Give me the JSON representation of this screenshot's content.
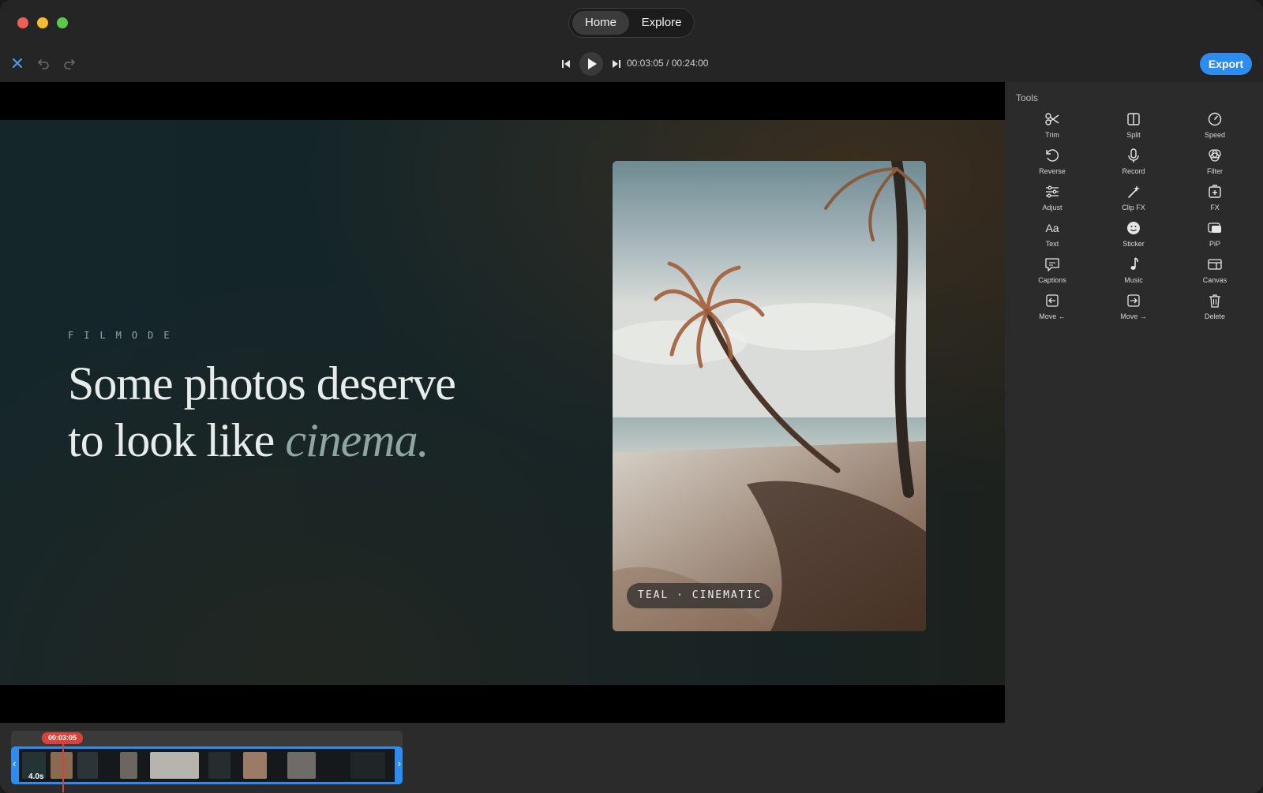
{
  "titlebar": {
    "tabs": [
      {
        "label": "Home",
        "selected": true
      },
      {
        "label": "Explore",
        "selected": false
      }
    ]
  },
  "toolbar": {
    "close_icon": "close-icon",
    "undo_icon": "undo-icon",
    "redo_icon": "redo-icon",
    "timecode": "00:03:05 / 00:24:00",
    "export_label": "Export",
    "accent_color": "#2d8cf0"
  },
  "preview": {
    "brand": "FILMODE",
    "headline_line1": "Some photos deserve",
    "headline_line2_prefix": "to look like ",
    "headline_line2_emphasis": "cinema.",
    "photo_tag": "TEAL · CINEMATIC",
    "background_color": "#14262a"
  },
  "tools": {
    "title": "Tools",
    "items": [
      {
        "label": "Trim",
        "icon": "scissors-icon"
      },
      {
        "label": "Split",
        "icon": "split-icon"
      },
      {
        "label": "Speed",
        "icon": "speedometer-icon"
      },
      {
        "label": "Reverse",
        "icon": "reverse-icon"
      },
      {
        "label": "Record",
        "icon": "microphone-icon"
      },
      {
        "label": "Filter",
        "icon": "filter-icon"
      },
      {
        "label": "Adjust",
        "icon": "sliders-icon"
      },
      {
        "label": "Clip FX",
        "icon": "magic-wand-icon"
      },
      {
        "label": "FX",
        "icon": "fx-icon"
      },
      {
        "label": "Text",
        "icon": "text-icon"
      },
      {
        "label": "Sticker",
        "icon": "smiley-icon"
      },
      {
        "label": "PiP",
        "icon": "pip-icon"
      },
      {
        "label": "Captions",
        "icon": "captions-icon"
      },
      {
        "label": "Music",
        "icon": "music-note-icon"
      },
      {
        "label": "Canvas",
        "icon": "canvas-icon"
      },
      {
        "label": "Move ←",
        "icon": "move-left-icon"
      },
      {
        "label": "Move →",
        "icon": "move-right-icon"
      },
      {
        "label": "Delete",
        "icon": "trash-icon"
      }
    ]
  },
  "timeline": {
    "playhead_time": "00:03:05",
    "clip_duration": "4.0s",
    "playhead_color": "#d9423a"
  }
}
